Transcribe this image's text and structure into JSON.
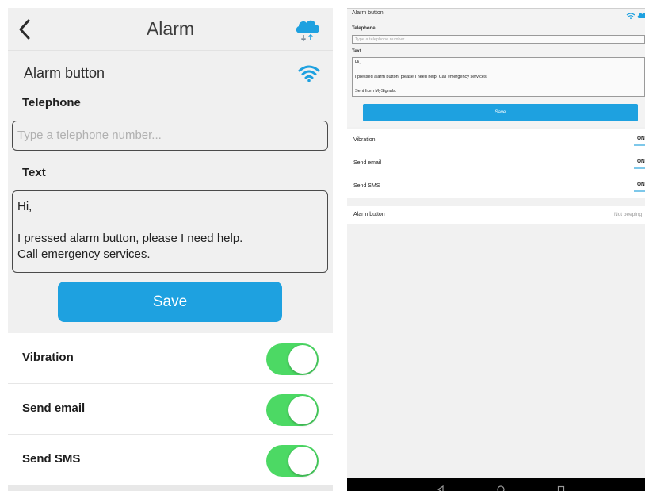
{
  "ios": {
    "nav_title": "Alarm",
    "section_title": "Alarm button",
    "telephone_label": "Telephone",
    "telephone_placeholder": "Type a telephone number...",
    "text_label": "Text",
    "text_lines": [
      "Hi,",
      "",
      "I pressed alarm button, please I need help.",
      "Call emergency services."
    ],
    "save_label": "Save",
    "toggles": [
      {
        "label": "Vibration",
        "on": true
      },
      {
        "label": "Send email",
        "on": true
      },
      {
        "label": "Send SMS",
        "on": true
      }
    ],
    "accent_color": "#1ea1e0",
    "toggle_color": "#4cd964"
  },
  "android": {
    "section_title": "Alarm button",
    "telephone_label": "Telephone",
    "telephone_placeholder": "Type a telephone number...",
    "text_label": "Text",
    "text_lines": [
      "Hi,",
      "",
      "I pressed alarm button, please I need help. Call emergency services.",
      "",
      "Sent from MySignals."
    ],
    "save_label": "Save",
    "toggles": [
      {
        "label": "Vibration",
        "state": "ON"
      },
      {
        "label": "Send email",
        "state": "ON"
      },
      {
        "label": "Send SMS",
        "state": "ON"
      }
    ],
    "alarm_row": {
      "label": "Alarm button",
      "value": "Not beeping"
    },
    "nav_icons": [
      "back-triangle-icon",
      "home-circle-icon",
      "recents-square-icon"
    ]
  }
}
